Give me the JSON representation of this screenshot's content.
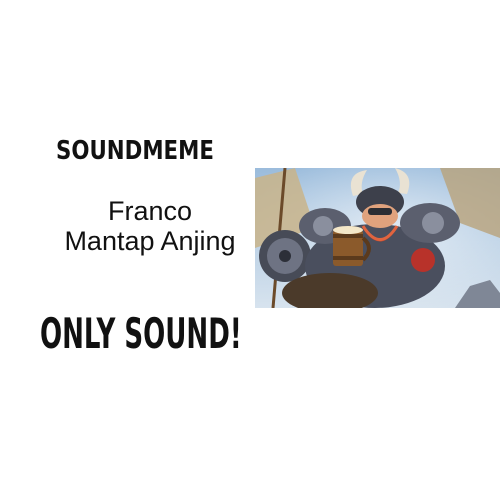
{
  "header": {
    "brand": "SOUNDMEME"
  },
  "title": {
    "line1": "Franco",
    "line2": "Mantap Anjing"
  },
  "tagline": "ONLY SOUND!",
  "artwork": {
    "subject": "viking-warrior-with-mug",
    "sky": "#8fb3d6",
    "beard": "#c8472b",
    "armor": "#5b5f6e"
  }
}
